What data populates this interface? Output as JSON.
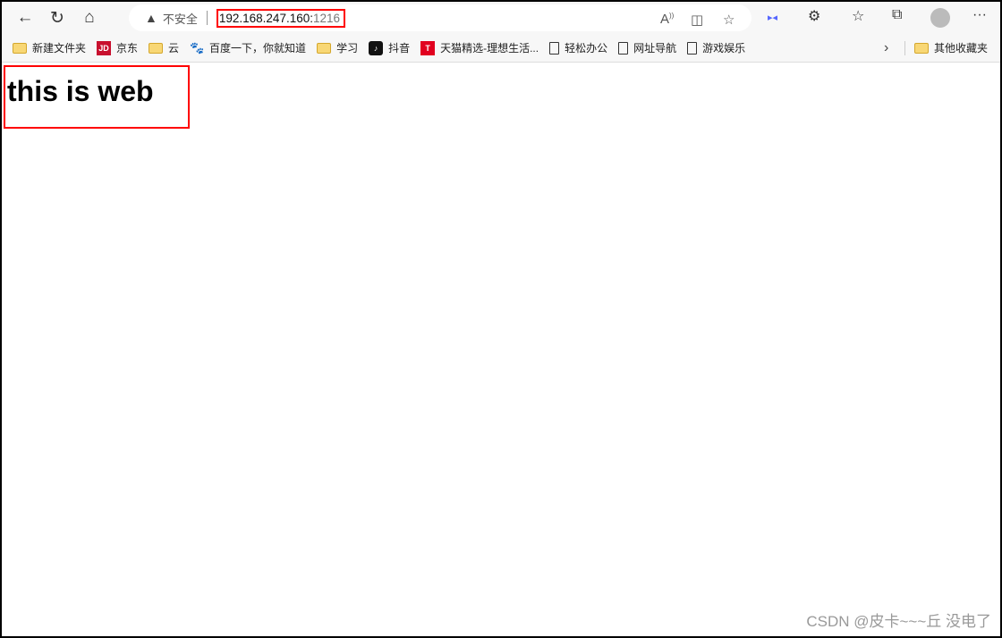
{
  "browser": {
    "security_label": "不安全",
    "url_host": "192.168.247.160:",
    "url_port": "1216",
    "bookmarks": [
      {
        "label": "新建文件夹",
        "icon": "folder-icon"
      },
      {
        "label": "京东",
        "icon": "jd-icon"
      },
      {
        "label": "云",
        "icon": "folder-icon"
      },
      {
        "label": "百度一下，你就知道",
        "icon": "baidu-icon"
      },
      {
        "label": "学习",
        "icon": "folder-icon"
      },
      {
        "label": "抖音",
        "icon": "douyin-icon"
      },
      {
        "label": "天猫精选-理想生活...",
        "icon": "tmall-icon"
      },
      {
        "label": "轻松办公",
        "icon": "page-icon"
      },
      {
        "label": "网址导航",
        "icon": "page-icon"
      },
      {
        "label": "游戏娱乐",
        "icon": "page-icon"
      }
    ],
    "other_bookmarks": "其他收藏夹"
  },
  "page": {
    "heading": "this is web"
  },
  "watermark": "CSDN @皮卡~~~丘 没电了",
  "colors": {
    "highlight": "#ff0000"
  }
}
